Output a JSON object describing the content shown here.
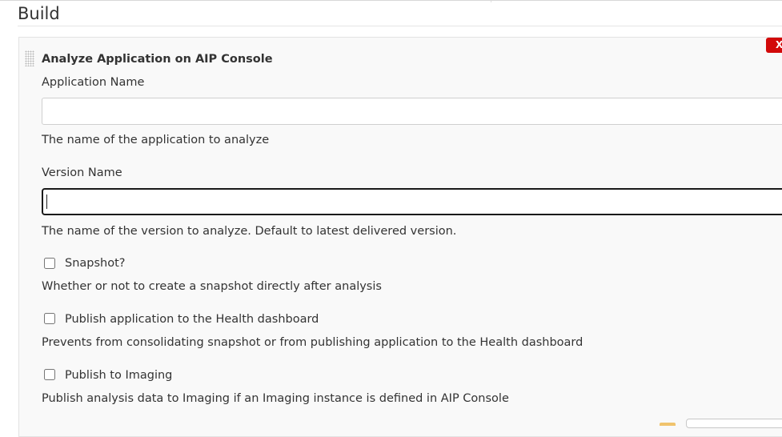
{
  "section": {
    "title": "Build"
  },
  "step": {
    "title": "Analyze Application on AIP Console",
    "delete_label": "X",
    "application_name": {
      "label": "Application Name",
      "value": "",
      "help": "The name of the application to analyze"
    },
    "version_name": {
      "label": "Version Name",
      "value": "",
      "help": "The name of the version to analyze. Default to latest delivered version."
    },
    "snapshot": {
      "label": "Snapshot?",
      "checked": false,
      "help": "Whether or not to create a snapshot directly after analysis"
    },
    "publish_health": {
      "label": "Publish application to the Health dashboard",
      "checked": false,
      "help": "Prevents from consolidating snapshot or from publishing application to the Health dashboard"
    },
    "publish_imaging": {
      "label": "Publish to Imaging",
      "checked": false,
      "help": "Publish analysis data to Imaging if an Imaging instance is defined in AIP Console"
    }
  },
  "colors": {
    "panel_bg": "#f9f9f9",
    "delete_red": "#d20a0a",
    "text": "#333333",
    "focus_border": "#1a1a1a"
  }
}
